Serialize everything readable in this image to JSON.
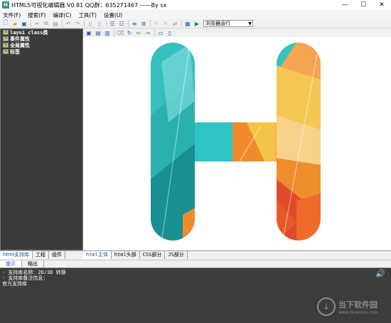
{
  "window": {
    "icon_letter": "H",
    "title": "HTML5可视化编辑器 V0.81 QQ群：635271467 ——By sx",
    "minimize": "—",
    "maximize": "☐",
    "close": "✕"
  },
  "menu": [
    "文件(F)",
    "搜索(F)",
    "编译(C)",
    "工具(T)",
    "设置(U)"
  ],
  "toolbar": {
    "browser_select_value": "浏览器运行"
  },
  "sidebar": {
    "items": [
      "layui class类",
      "事件属性",
      "全局属性",
      "标签"
    ],
    "tabs": [
      "html支持库",
      "工程",
      "组件"
    ]
  },
  "editor": {
    "tabs": [
      "html主体",
      "html头部",
      "CSS部分",
      "JS部分"
    ]
  },
  "bottom": {
    "tabs": [
      "提示",
      "输出"
    ],
    "console_lines": [
      "· 支持库名称：2D/3D 转换",
      "· 支持库备注信息：",
      "官方支持库"
    ]
  },
  "watermark": {
    "name": "当下软件园",
    "url": "www.downxia.com"
  },
  "colors": {
    "teal": "#2aa3a3",
    "orange": "#f08a2c",
    "yellow": "#f4c44a",
    "red": "#e04a2a"
  }
}
